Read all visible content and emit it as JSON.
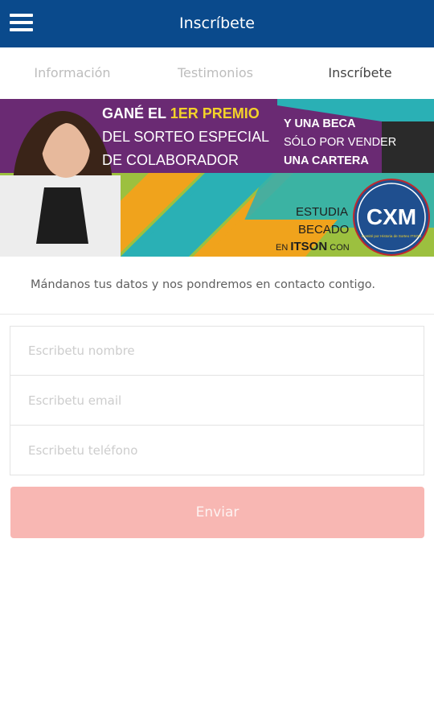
{
  "appbar": {
    "title": "Inscríbete",
    "menu_icon": "hamburger-menu-icon"
  },
  "tabs": [
    {
      "label": "Información",
      "selected": false
    },
    {
      "label": "Testimonios",
      "selected": false
    },
    {
      "label": "Inscríbete",
      "selected": true
    }
  ],
  "banner": {
    "line1_a": "GANÉ EL ",
    "line1_b": "1ER PREMIO",
    "line2": "DEL SORTEO ESPECIAL",
    "line3": "DE COLABORADOR",
    "right_line1_a": "Y ",
    "right_line1_b": "UNA BECA",
    "right_line2": "SÓLO POR VENDER",
    "right_line3": "UNA CARTERA",
    "estudia": "ESTUDIA",
    "becado": "BECADO",
    "en": "EN ",
    "itson": "ITSON",
    "con": " CON",
    "logo_text": "CXM",
    "logo_subtext": "Comité por Historia de Sorteo ITSON",
    "colors": {
      "purple": "#6a2a73",
      "dark": "#2a2a2a",
      "teal": "#2ab0b5",
      "green": "#9cc03f",
      "orange": "#f0a31c"
    }
  },
  "intro": {
    "text": "Mándanos tus datos y nos pondremos en contacto contigo."
  },
  "form": {
    "name_placeholder": "Escribetu nombre",
    "email_placeholder": "Escribetu email",
    "phone_placeholder": "Escribetu teléfono",
    "submit_label": "Enviar"
  }
}
